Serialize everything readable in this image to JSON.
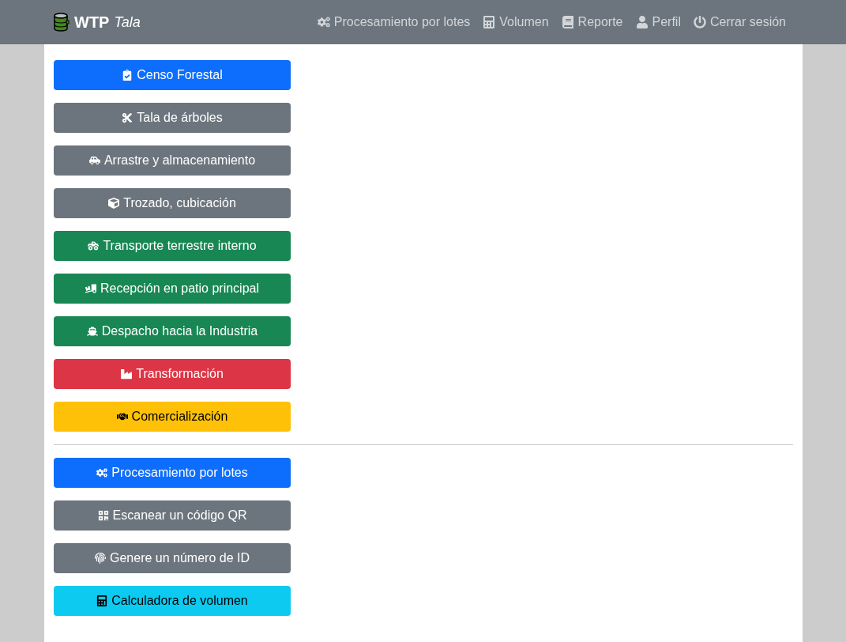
{
  "brand": {
    "name": "WTP",
    "subtitle": "Tala"
  },
  "nav": [
    {
      "label": "Procesamiento por lotes"
    },
    {
      "label": "Volumen"
    },
    {
      "label": "Reporte"
    },
    {
      "label": "Perfil"
    },
    {
      "label": "Cerrar sesión"
    }
  ],
  "stages": [
    {
      "label": "Censo Forestal",
      "kind": "primary"
    },
    {
      "label": "Tala de árboles",
      "kind": "secondary"
    },
    {
      "label": "Arrastre y almacenamiento",
      "kind": "secondary"
    },
    {
      "label": "Trozado, cubicación",
      "kind": "secondary"
    },
    {
      "label": "Transporte terrestre interno",
      "kind": "success"
    },
    {
      "label": "Recepción en patio principal",
      "kind": "success"
    },
    {
      "label": "Despacho hacia la Industria",
      "kind": "success"
    },
    {
      "label": "Transformación",
      "kind": "danger"
    },
    {
      "label": "Comercialización",
      "kind": "warning"
    }
  ],
  "tools": [
    {
      "label": "Procesamiento por lotes",
      "kind": "primary"
    },
    {
      "label": "Escanear un código QR",
      "kind": "secondary"
    },
    {
      "label": "Genere un número de ID",
      "kind": "secondary"
    },
    {
      "label": "Calculadora de volumen",
      "kind": "info"
    }
  ]
}
